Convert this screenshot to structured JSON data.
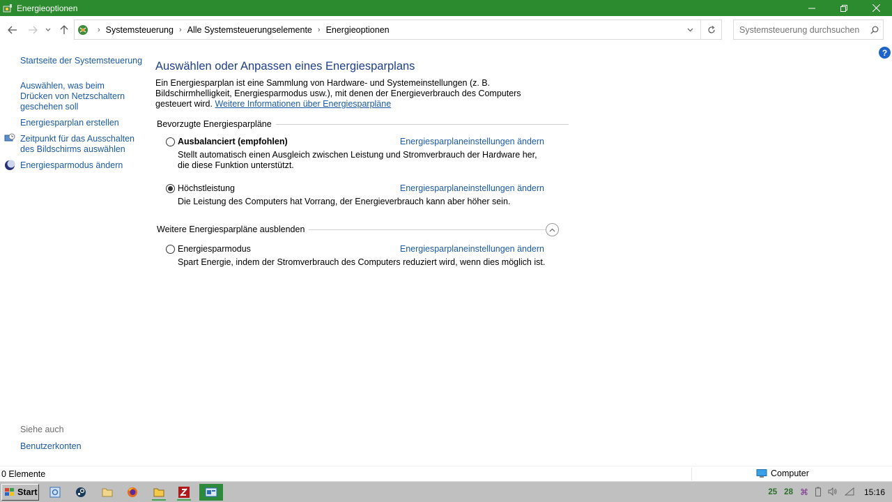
{
  "window": {
    "title": "Energieoptionen",
    "accent_color": "#2c8a2f"
  },
  "address": {
    "crumbs": [
      "Systemsteuerung",
      "Alle Systemsteuerungselemente",
      "Energieoptionen"
    ],
    "search_placeholder": "Systemsteuerung durchsuchen"
  },
  "help_label": "?",
  "sidebar": {
    "home": "Startseite der Systemsteuerung",
    "power_buttons": "Auswählen, was beim Drücken von Netzschaltern geschehen soll",
    "create_plan": "Energiesparplan erstellen",
    "display_off": "Zeitpunkt für das Ausschalten des Bildschirms auswählen",
    "saver_mode": "Energiesparmodus ändern",
    "see_also": "Siehe auch",
    "user_accounts": "Benutzerkonten"
  },
  "main": {
    "heading": "Auswählen oder Anpassen eines Energiesparplans",
    "intro_text": "Ein Energiesparplan ist eine Sammlung von Hardware- und Systemeinstellungen (z. B. Bildschirmhelligkeit, Energiesparmodus usw.), mit denen der Energieverbrauch des Computers gesteuert wird. ",
    "intro_link": "Weitere Informationen über Energiesparpläne",
    "preferred_section": "Bevorzugte Energiesparpläne",
    "more_section": "Weitere Energiesparpläne ausblenden",
    "plans": [
      {
        "name": "Ausbalanciert (empfohlen)",
        "selected": false,
        "link": "Energiesparplaneinstellungen ändern",
        "desc": "Stellt automatisch einen Ausgleich zwischen Leistung und Stromverbrauch der Hardware her, die diese Funktion unterstützt."
      },
      {
        "name": "Höchstleistung",
        "selected": true,
        "link": "Energiesparplaneinstellungen ändern",
        "desc": "Die Leistung des Computers hat Vorrang, der Energieverbrauch kann aber höher sein."
      },
      {
        "name": "Energiesparmodus",
        "selected": false,
        "link": "Energiesparplaneinstellungen ändern",
        "desc": "Spart Energie, indem der Stromverbrauch des Computers reduziert wird, wenn dies möglich ist."
      }
    ]
  },
  "statusbar": {
    "items_count": "0 Elemente",
    "location": "Computer"
  },
  "taskbar": {
    "start_label": "Start",
    "tray_nums": [
      "25",
      "28"
    ],
    "clock": "15:16",
    "apps": [
      "control-panel",
      "steam",
      "file-manager",
      "firefox",
      "file-explorer",
      "filezilla",
      "control-panel-active"
    ]
  }
}
